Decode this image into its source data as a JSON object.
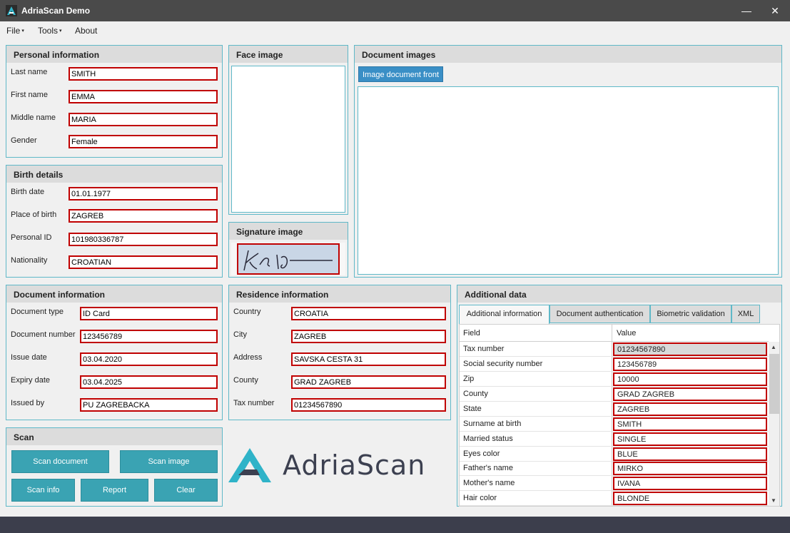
{
  "window": {
    "title": "AdriaScan Demo",
    "minimize_glyph": "—",
    "close_glyph": "✕"
  },
  "menu": {
    "file": "File",
    "tools": "Tools",
    "about": "About",
    "caret": "▾"
  },
  "personal": {
    "header": "Personal information",
    "last_name_label": "Last name",
    "last_name": "SMITH",
    "first_name_label": "First name",
    "first_name": "EMMA",
    "middle_name_label": "Middle name",
    "middle_name": "MARIA",
    "gender_label": "Gender",
    "gender": "Female"
  },
  "birth": {
    "header": "Birth details",
    "date_label": "Birth date",
    "date": "01.01.1977",
    "place_label": "Place of birth",
    "place": "ZAGREB",
    "pid_label": "Personal ID",
    "pid": "101980336787",
    "nationality_label": "Nationality",
    "nationality": "CROATIAN"
  },
  "face": {
    "header": "Face image"
  },
  "signature": {
    "header": "Signature image"
  },
  "docimages": {
    "header": "Document images",
    "tab_front": "Image document front"
  },
  "document": {
    "header": "Document information",
    "type_label": "Document type",
    "type": "ID Card",
    "number_label": "Document number",
    "number": "123456789",
    "issue_label": "Issue date",
    "issue": "03.04.2020",
    "expiry_label": "Expiry date",
    "expiry": "03.04.2025",
    "issued_by_label": "Issued by",
    "issued_by": "PU ZAGREBACKA"
  },
  "residence": {
    "header": "Residence information",
    "country_label": "Country",
    "country": "CROATIA",
    "city_label": "City",
    "city": "ZAGREB",
    "address_label": "Address",
    "address": "SAVSKA CESTA 31",
    "county_label": "County",
    "county": "GRAD ZAGREB",
    "tax_label": "Tax number",
    "tax": "01234567890"
  },
  "scan": {
    "header": "Scan",
    "scan_document": "Scan document",
    "scan_image": "Scan image",
    "scan_info": "Scan info",
    "report": "Report",
    "clear": "Clear"
  },
  "logo": {
    "text": "AdriaScan"
  },
  "additional": {
    "header": "Additional data",
    "tabs": [
      "Additional information",
      "Document authentication",
      "Biometric validation",
      "XML"
    ],
    "col_field": "Field",
    "col_value": "Value",
    "rows": [
      {
        "field": "Tax number",
        "value": "01234567890"
      },
      {
        "field": "Social security number",
        "value": "123456789"
      },
      {
        "field": "Zip",
        "value": "10000"
      },
      {
        "field": "County",
        "value": "GRAD ZAGREB"
      },
      {
        "field": "State",
        "value": "ZAGREB"
      },
      {
        "field": "Surname at birth",
        "value": "SMITH"
      },
      {
        "field": "Married status",
        "value": "SINGLE"
      },
      {
        "field": "Eyes color",
        "value": "BLUE"
      },
      {
        "field": "Father's name",
        "value": "MIRKO"
      },
      {
        "field": "Mother's name",
        "value": "IVANA"
      },
      {
        "field": "Hair color",
        "value": "BLONDE"
      }
    ]
  },
  "colors": {
    "accent": "#3aa3b3",
    "error_border": "#c00000",
    "titlebar": "#4a4a4a",
    "logo_teal": "#2fb3c8",
    "logo_text": "#3c4050"
  }
}
